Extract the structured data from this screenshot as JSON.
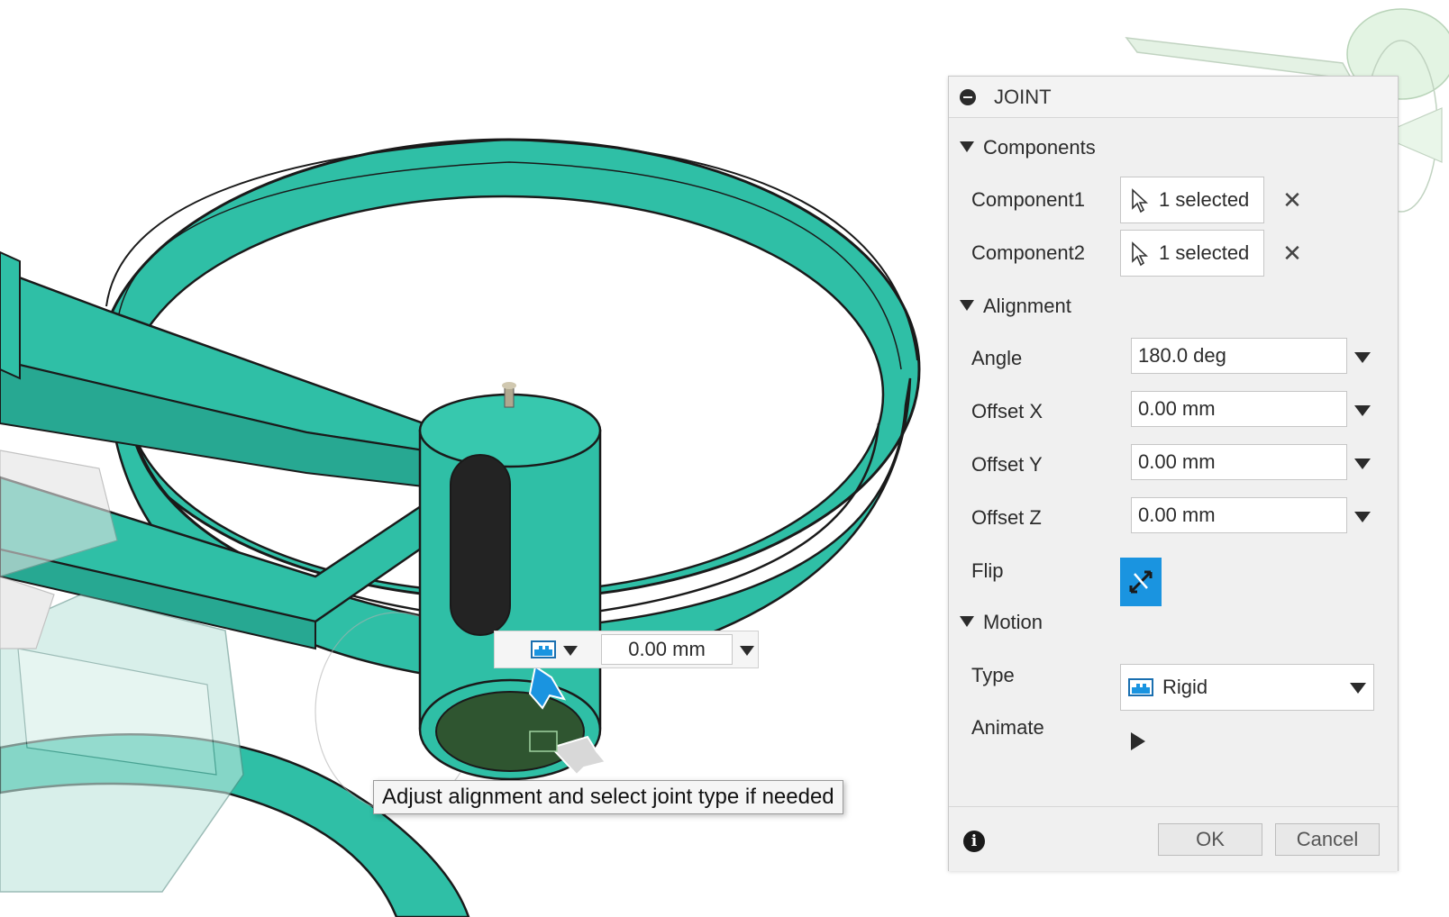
{
  "colors": {
    "model_teal": "#2fbfa6",
    "model_edge": "#1a1a1a",
    "accent_blue": "#1a94e0",
    "panel_bg": "#f0f0f0"
  },
  "panel": {
    "title": "JOINT",
    "collapse_icon": "minus-circle-icon",
    "sections": {
      "components": "Components",
      "alignment": "Alignment",
      "motion": "Motion"
    },
    "component1": {
      "label": "Component1",
      "value": "1 selected"
    },
    "component2": {
      "label": "Component2",
      "value": "1 selected"
    },
    "angle": {
      "label": "Angle",
      "value": "180.0 deg"
    },
    "offset_x": {
      "label": "Offset X",
      "value": "0.00 mm"
    },
    "offset_y": {
      "label": "Offset Y",
      "value": "0.00 mm"
    },
    "offset_z": {
      "label": "Offset Z",
      "value": "0.00 mm"
    },
    "flip": {
      "label": "Flip"
    },
    "type": {
      "label": "Type",
      "value": "Rigid"
    },
    "animate": {
      "label": "Animate"
    },
    "ok_label": "OK",
    "cancel_label": "Cancel"
  },
  "manipulator": {
    "value": "0.00 mm"
  },
  "tooltip": "Adjust alignment and select joint type if needed"
}
